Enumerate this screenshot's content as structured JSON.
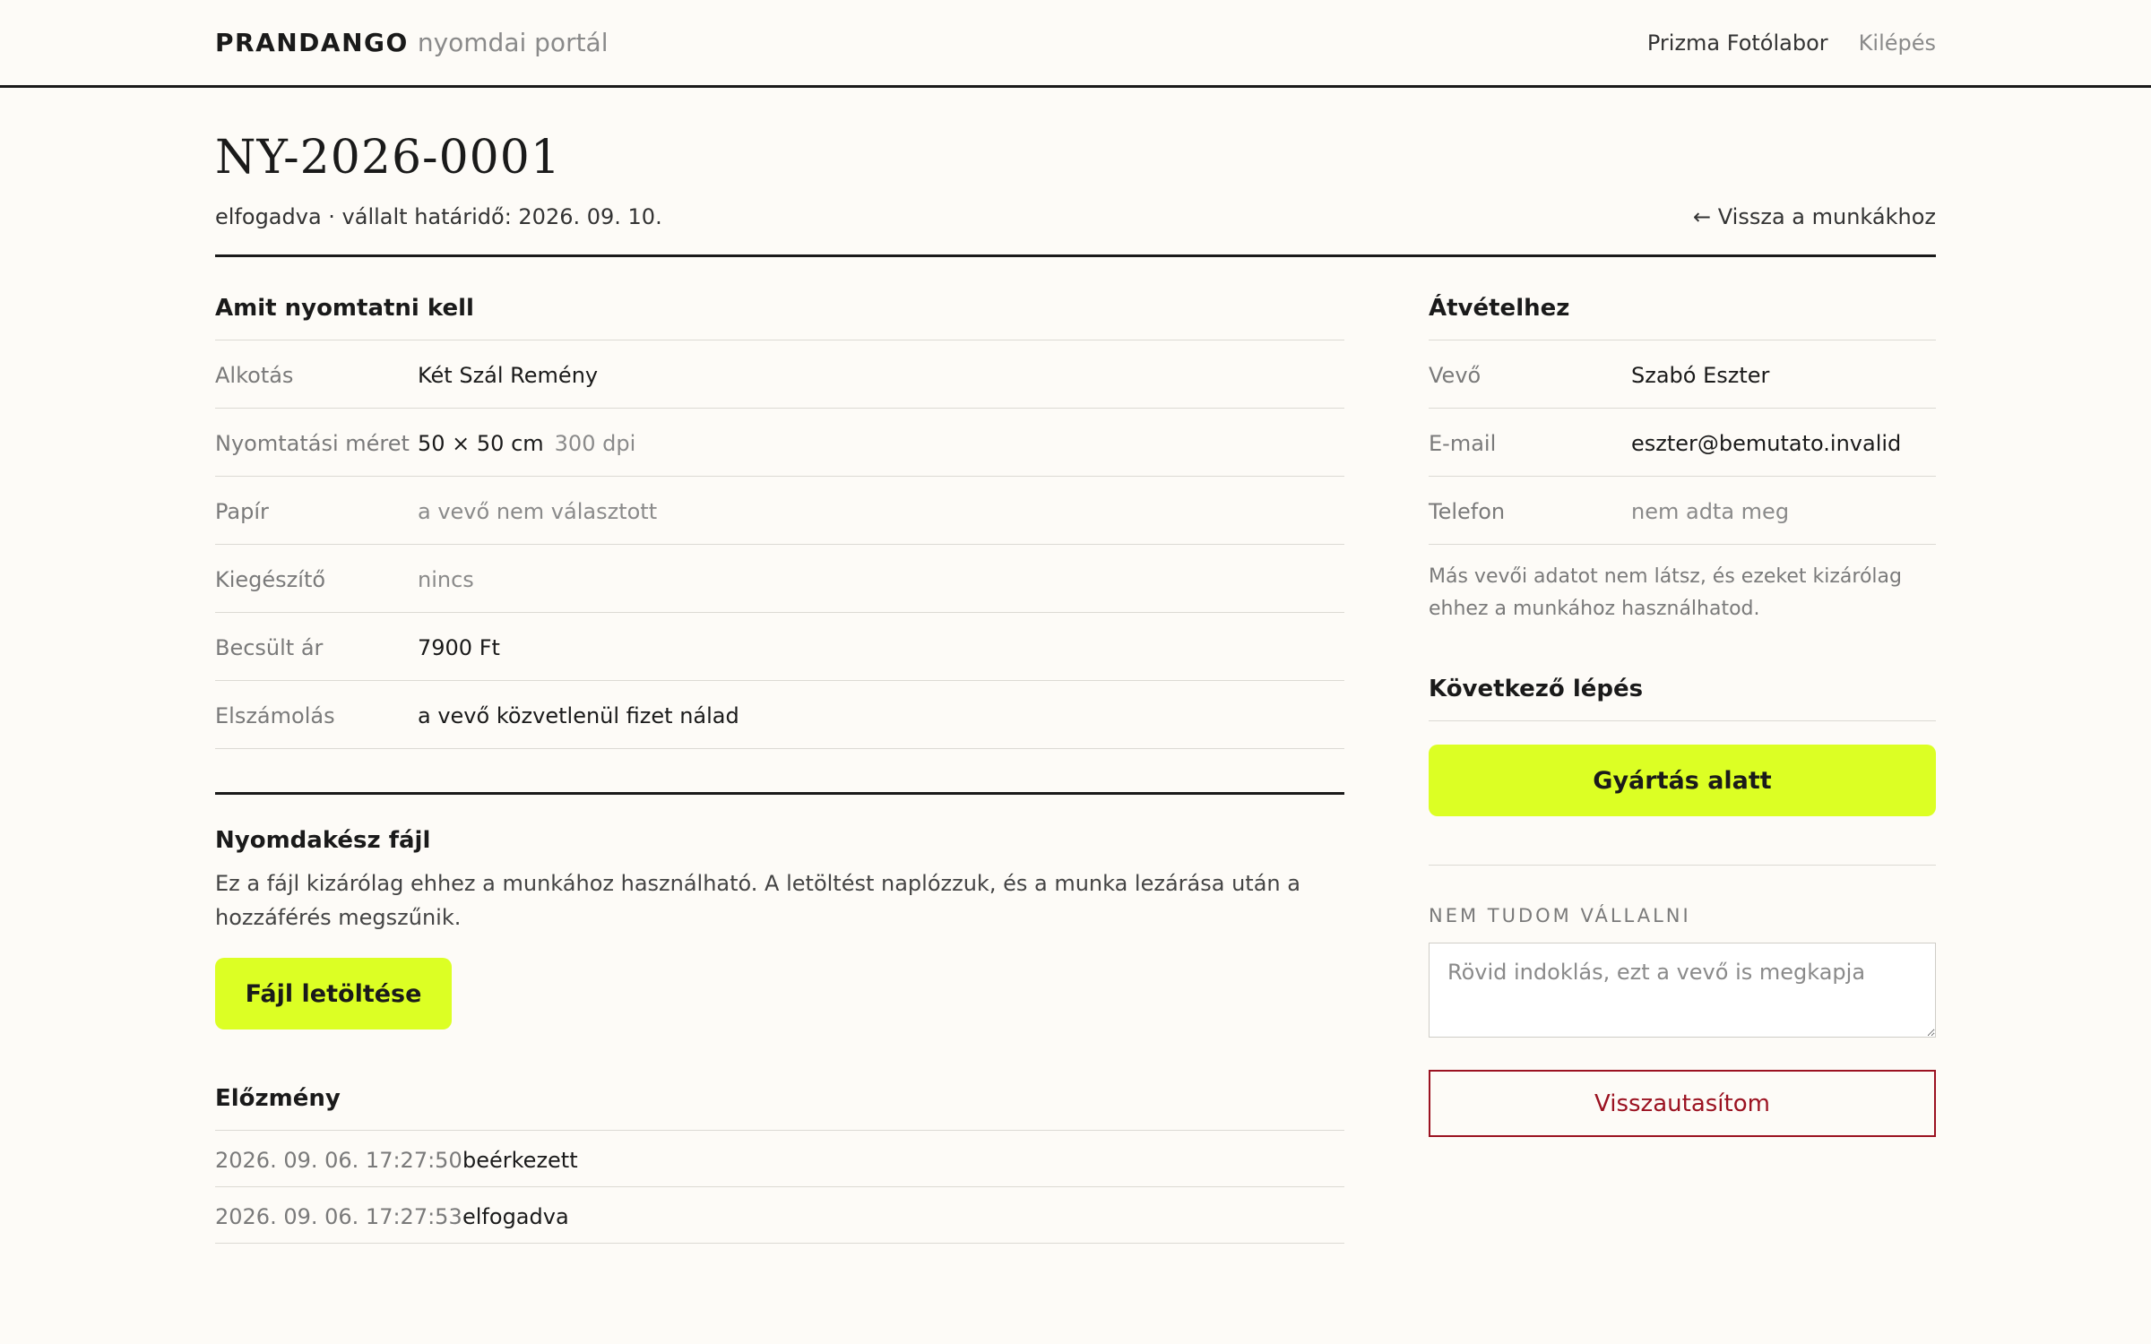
{
  "header": {
    "brand_strong": "PRANDANGO",
    "brand_light": "nyomdai portál",
    "studio_name": "Prizma Fotólabor",
    "logout": "Kilépés"
  },
  "order": {
    "id": "NY-2026-0001",
    "status_line": "elfogadva · vállalt határidő: 2026. 09. 10.",
    "back_link": "← Vissza a munkákhoz"
  },
  "print_details": {
    "title": "Amit nyomtatni kell",
    "rows": [
      {
        "label": "Alkotás",
        "value": "Két Szál Remény"
      },
      {
        "label": "Nyomtatási méret",
        "value": "50 × 50 cm",
        "extra": "300 dpi"
      },
      {
        "label": "Papír",
        "value": "a vevő nem választott"
      },
      {
        "label": "Kiegészítő",
        "value": "nincs"
      },
      {
        "label": "Becsült ár",
        "value": "7900 Ft"
      },
      {
        "label": "Elszámolás",
        "value": "a vevő közvetlenül fizet nálad"
      }
    ]
  },
  "print_file": {
    "title": "Nyomdakész fájl",
    "note": "Ez a fájl kizárólag ehhez a munkához használható. A letöltést naplózzuk, és a munka lezárása után a hozzáférés megszűnik.",
    "download_label": "Fájl letöltése"
  },
  "history": {
    "title": "Előzmény",
    "rows": [
      {
        "timestamp": "2026. 09. 06. 17:27:50",
        "event": "beérkezett"
      },
      {
        "timestamp": "2026. 09. 06. 17:27:53",
        "event": "elfogadva"
      }
    ]
  },
  "pickup": {
    "title": "Átvételhez",
    "rows": [
      {
        "label": "Vevő",
        "value": "Szabó Eszter"
      },
      {
        "label": "E-mail",
        "value": "eszter@bemutato.invalid"
      },
      {
        "label": "Telefon",
        "value": "nem adta meg"
      }
    ],
    "note": "Más vevői adatot nem látsz, és ezeket kizárólag ehhez a munkához használhatod."
  },
  "next_step": {
    "title": "Következő lépés",
    "button_label": "Gyártás alatt"
  },
  "decline": {
    "label": "NEM TUDOM VÁLLALNI",
    "placeholder": "Rövid indoklás, ezt a vevő is megkapja",
    "button_label": "Visszautasítom"
  },
  "colors": {
    "accent_lime": "#dcff24",
    "danger": "#9b1221",
    "background": "#fdfbf7"
  }
}
